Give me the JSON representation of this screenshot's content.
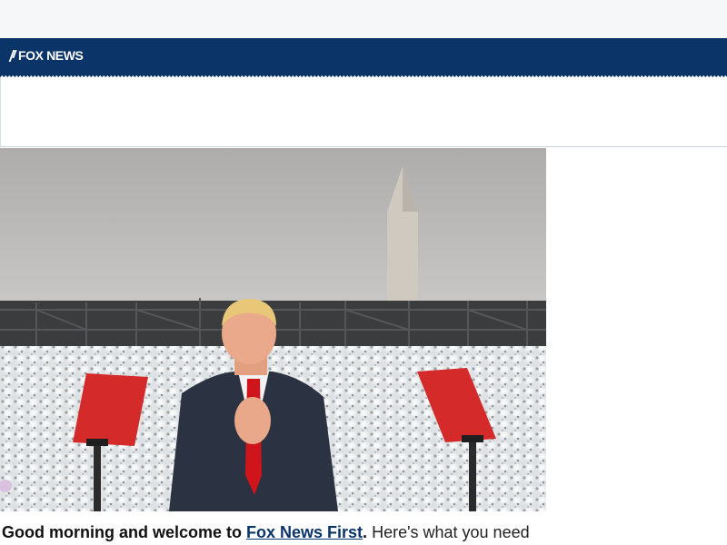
{
  "header": {
    "logo_text": "FOX NEWS",
    "bar_color": "#0b3468"
  },
  "hero": {
    "image_subject": "person-clapping-at-podium-photo"
  },
  "intro": {
    "greeting": "Good morning and welcome to ",
    "link_text": "Fox News First",
    "period": ".",
    "rest": " Here's what you need"
  }
}
